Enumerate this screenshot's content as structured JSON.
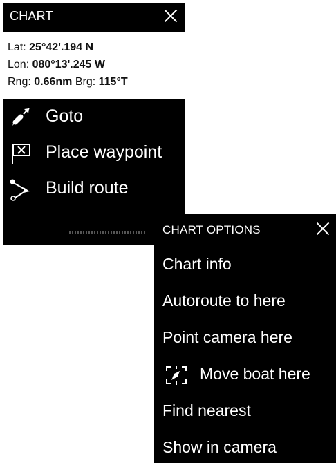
{
  "chart_menu": {
    "title": "CHART",
    "lat_label": "Lat:",
    "lat_value": "25°42'.194 N",
    "lon_label": "Lon:",
    "lon_value": "080°13'.245 W",
    "rng_label": "Rng:",
    "rng_value": "0.66nm",
    "brg_label": "Brg:",
    "brg_value": "115°T",
    "items": [
      {
        "label": "Goto",
        "icon": "goto-icon"
      },
      {
        "label": "Place waypoint",
        "icon": "waypoint-flag-icon"
      },
      {
        "label": "Build route",
        "icon": "route-icon"
      }
    ]
  },
  "options_menu": {
    "title": "CHART OPTIONS",
    "items": [
      {
        "label": "Chart info"
      },
      {
        "label": "Autoroute to here"
      },
      {
        "label": "Point camera here"
      },
      {
        "label": "Move boat here",
        "icon": "move-boat-icon"
      },
      {
        "label": "Find nearest"
      },
      {
        "label": "Show in camera"
      }
    ]
  },
  "colors": {
    "panel": "#000000",
    "info_bg": "#ffffff",
    "text": "#ffffff"
  }
}
